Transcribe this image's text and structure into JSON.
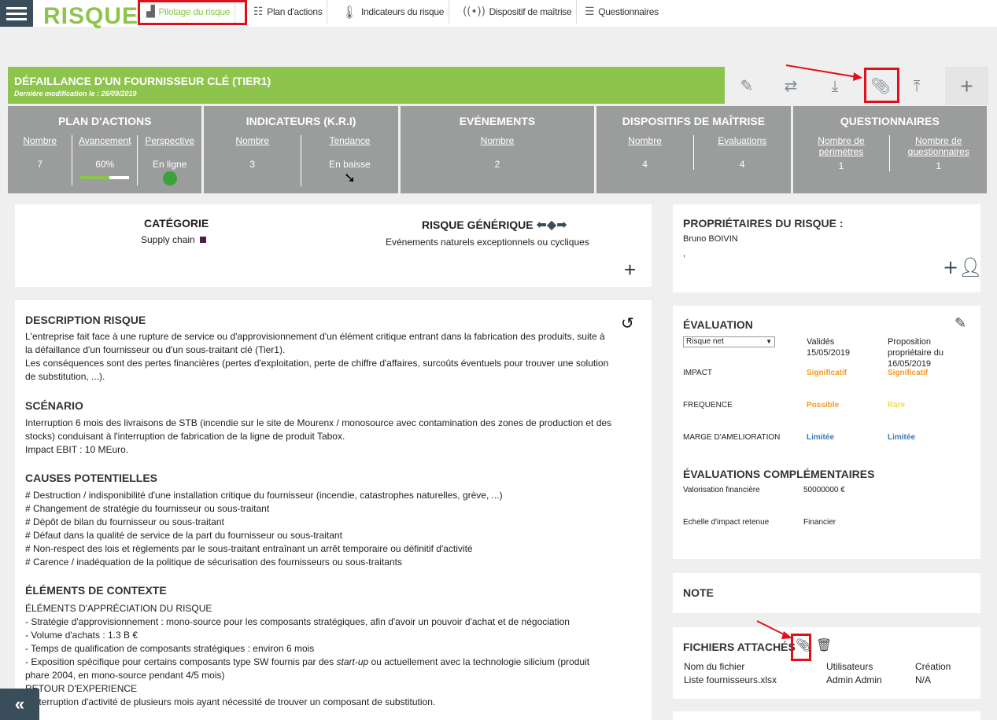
{
  "app": {
    "title": "RISQUE"
  },
  "nav": [
    {
      "label": "Pilotage du risque",
      "icon": "bar-chart-icon"
    },
    {
      "label": "Plan d'actions",
      "icon": "people-table-icon"
    },
    {
      "label": "Indicateurs du risque",
      "icon": "thermometer-icon"
    },
    {
      "label": "Dispositif de maîtrise",
      "icon": "broadcast-icon"
    },
    {
      "label": "Questionnaires",
      "icon": "list-icon"
    }
  ],
  "risk": {
    "title": "DÉFAILLANCE D'UN FOURNISSEUR CLÉ (TIER1)",
    "modified": "Dernière modification le : 26/09/2019"
  },
  "summary": {
    "plan": {
      "title": "PLAN D'ACTIONS",
      "nombre_label": "Nombre",
      "nombre": "7",
      "avancement_label": "Avancement",
      "avancement": "60%",
      "avancement_fraction": 0.6,
      "perspective_label": "Perspective",
      "perspective": "En ligne"
    },
    "indicateurs": {
      "title": "INDICATEURS (K.R.I)",
      "nombre_label": "Nombre",
      "nombre": "3",
      "tendance_label": "Tendance",
      "tendance": "En baisse"
    },
    "evenements": {
      "title": "EVÉNEMENTS",
      "nombre_label": "Nombre",
      "nombre": "2"
    },
    "dispositifs": {
      "title": "DISPOSITIFS DE MAÎTRISE",
      "nombre_label": "Nombre",
      "nombre": "4",
      "evaluations_label": "Evaluations",
      "evaluations": "4"
    },
    "questionnaires": {
      "title": "QUESTIONNAIRES",
      "perimetres_label1": "Nombre de",
      "perimetres_label2": "périmètres",
      "perimetres": "1",
      "questionnaires_label1": "Nombre de",
      "questionnaires_label2": "questionnaires",
      "questionnaires": "1"
    }
  },
  "category": {
    "cat_title": "CATÉGORIE",
    "cat_value": "Supply chain",
    "generic_title": "RISQUE GÉNÉRIQUE",
    "generic_value": "Evénements naturels exceptionnels ou cycliques"
  },
  "description": {
    "title": "DESCRIPTION RISQUE",
    "lines": [
      "L'entreprise fait face à une rupture de service ou d'approvisionnement d'un élément critique entrant dans la fabrication des produits, suite à",
      "la défaillance d'un fournisseur ou d'un sous-traitant clé (Tier1).",
      "Les conséquences sont des pertes financières (pertes d'exploitation, perte de chiffre d'affaires, surcoûts éventuels pour trouver une solution",
      "de substitution, ...)."
    ],
    "scenario_title": "SCÉNARIO",
    "scenario_lines": [
      "Interruption 6 mois des livraisons de STB (incendie sur le site de Mourenx / monosource avec contamination des zones de production et des",
      "stocks) conduisant à l'interruption de fabrication de la ligne de produit Tabox.",
      "Impact EBIT : 10 MEuro."
    ],
    "causes_title": "CAUSES POTENTIELLES",
    "causes_lines": [
      "# Destruction / indisponibilité d'une installation critique du fournisseur (incendie, catastrophes naturelles, grève, ...)",
      "# Changement de stratégie du fournisseur ou sous-traitant",
      "# Dépôt de bilan du fournisseur ou sous-traitant",
      "# Défaut dans la qualité de service de la part du fournisseur ou sous-traitant",
      "# Non-respect des lois et règlements par le sous-traitant entraînant un arrêt temporaire ou définitif d'activité",
      "# Carence / inadéquation de la politique de sécurisation des fournisseurs ou sous-traitants"
    ],
    "context_title": "ÉLÉMENTS DE CONTEXTE",
    "context_lines": [
      "ÉLÉMENTS D'APPRÉCIATION DU RISQUE",
      "- Stratégie d'approvisionnement : mono-source pour les composants stratégiques, afin d'avoir un pouvoir d'achat et de négociation",
      "- Volume d'achats : 1.3 B €",
      "- Temps de qualification de composants stratégiques : environ 6 mois"
    ],
    "context_expo_a": "- Exposition spécifique pour certains composants type SW fournis par des ",
    "context_expo_em": "start-up",
    "context_expo_b": " ou actuellement avec la technologie silicium (produit",
    "context_lines2": [
      "phare 2004, en mono-source pendant 4/5 mois)",
      "RETOUR D'EXPERIENCE",
      "- Interruption d'activité de plusieurs mois ayant nécessité de trouver un composant de substitution."
    ]
  },
  "owners": {
    "title": "PROPRIÉTAIRES DU RISQUE :",
    "name": "Bruno BOIVIN",
    "extra": ","
  },
  "evaluation": {
    "title": "ÉVALUATION",
    "select_value": "Risque net",
    "validated_label": "Validés",
    "validated_date": "15/05/2019",
    "proposal_label1": "Proposition",
    "proposal_label2": "propriétaire du",
    "proposal_date": "16/05/2019",
    "rows": [
      {
        "label": "IMPACT",
        "validated": "Significatif",
        "proposal": "Significatif"
      },
      {
        "label": "FREQUENCE",
        "validated": "Possible",
        "proposal": "Rare"
      },
      {
        "label": "MARGE D'AMELIORATION",
        "validated": "Limitée",
        "proposal": "Limitée"
      }
    ],
    "colors": {
      "orange": "#f39a1e",
      "yellow": "#f0dc4a",
      "blue": "#3a7ab8"
    },
    "compl_title": "ÉVALUATIONS COMPLÉMENTAIRES",
    "compl_rows": [
      {
        "label": "Valorisation financière",
        "value": "50000000 €"
      },
      {
        "label": "Echelle d'impact retenue",
        "value": "Financier"
      }
    ]
  },
  "note": {
    "title": "NOTE"
  },
  "files": {
    "title": "FICHIERS ATTACHÉS",
    "col_name": "Nom du fichier",
    "col_users": "Utilisateurs",
    "col_created": "Création",
    "rows": [
      {
        "name": "Liste fournisseurs.xlsx",
        "users": "Admin Admin",
        "created": "N/A"
      }
    ]
  },
  "theme": {
    "brand_green": "#8dc44b",
    "nav_dark": "#3a4d5a",
    "summary_gray": "#9b9c9c",
    "highlight_red": "#e0101a"
  }
}
